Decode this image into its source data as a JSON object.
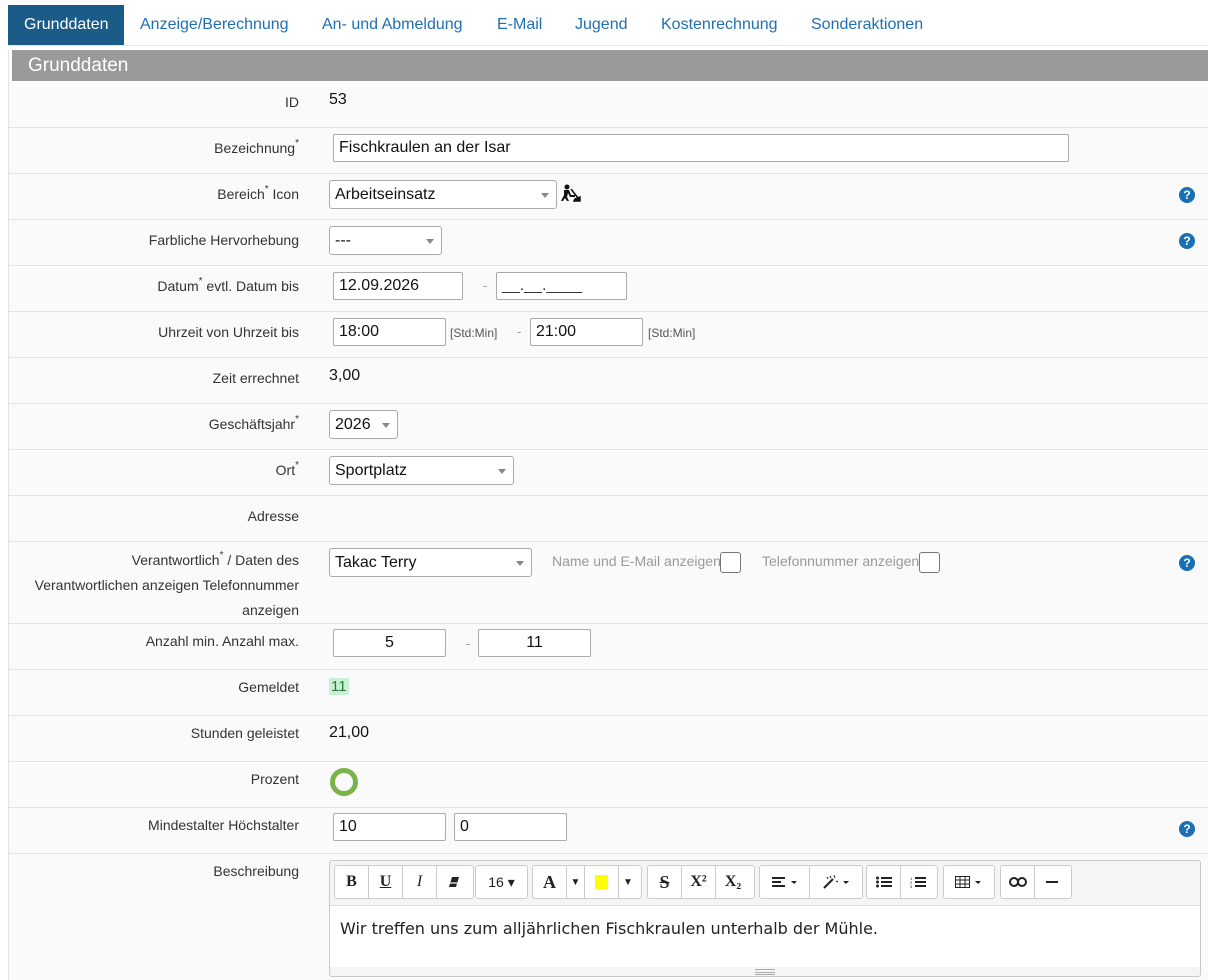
{
  "tabs": [
    {
      "label": "Grunddaten",
      "active": true
    },
    {
      "label": "Anzeige/Berechnung"
    },
    {
      "label": "An- und Abmeldung"
    },
    {
      "label": "E-Mail"
    },
    {
      "label": "Jugend"
    },
    {
      "label": "Kostenrechnung"
    },
    {
      "label": "Sonderaktionen"
    }
  ],
  "section": {
    "title": "Grunddaten"
  },
  "fields": {
    "id": {
      "label": "ID",
      "value": "53"
    },
    "bezeichnung": {
      "label": "Bezeichnung",
      "required": "*",
      "value": "Fischkraulen an der Isar"
    },
    "bereich": {
      "label_a": "Bereich",
      "required": "*",
      "label_b": "Icon",
      "value": "Arbeitseinsatz",
      "icon": "worker-digging-icon"
    },
    "hervorhebung": {
      "label": "Farbliche Hervorhebung",
      "value": "---"
    },
    "datum": {
      "label_a": "Datum",
      "required": "*",
      "label_b": "evtl. Datum bis",
      "from": "12.09.2026",
      "to_placeholder": "__.__.____",
      "dash": "-"
    },
    "uhrzeit": {
      "label": "Uhrzeit von Uhrzeit bis",
      "from": "18:00",
      "to": "21:00",
      "hint": "[Std:Min]",
      "dash": "-"
    },
    "zeit": {
      "label": "Zeit errechnet",
      "value": "3,00"
    },
    "geschaeftsjahr": {
      "label": "Geschäftsjahr",
      "required": "*",
      "value": "2026"
    },
    "ort": {
      "label": "Ort",
      "required": "*",
      "value": "Sportplatz"
    },
    "adresse": {
      "label": "Adresse"
    },
    "verantwortlich": {
      "label_a": "Verantwortlich",
      "required": "*",
      "label_b": "/ Daten des",
      "label_c": "Verantwortlichen anzeigen Telefonnummer",
      "label_d": "anzeigen",
      "value": "Takac Terry",
      "check1_label": "Name und E-Mail anzeigen",
      "check2_label": "Telefonnummer anzeigen",
      "check1": false,
      "check2": false
    },
    "anzahl": {
      "label": "Anzahl min. Anzahl max.",
      "min": "5",
      "max": "11",
      "dash": "-"
    },
    "gemeldet": {
      "label": "Gemeldet",
      "value": "11"
    },
    "stunden": {
      "label": "Stunden geleistet",
      "value": "21,00"
    },
    "prozent": {
      "label": "Prozent",
      "value": 0
    },
    "alter": {
      "label": "Mindestalter Höchstalter",
      "min": "10",
      "max": "0"
    },
    "beschreibung": {
      "label": "Beschreibung",
      "text": "Wir treffen uns zum alljährlichen Fischkraulen unterhalb der Mühle."
    }
  },
  "help_icon": "?",
  "editor_toolbar": {
    "bold": "B",
    "underline": "U",
    "italic": "I",
    "eraser": "eraser-icon",
    "font_size": "16",
    "font_color": "A",
    "highlight_color": "#ffff00",
    "strikethrough": "S",
    "superscript": "X²",
    "subscript": "X₂",
    "align": "align-icon",
    "magic": "magic-wand-icon",
    "bullets": "bullet-list-icon",
    "numbers": "numbered-list-icon",
    "table": "table-icon",
    "link": "link-icon",
    "hr": "horizontal-rule-icon"
  },
  "colors": {
    "tab_active": "#1a5b87",
    "tab_link": "#1f6fb2",
    "header": "#9a9a9a",
    "help": "#1a6fb5",
    "ring": "#7ab34a"
  }
}
